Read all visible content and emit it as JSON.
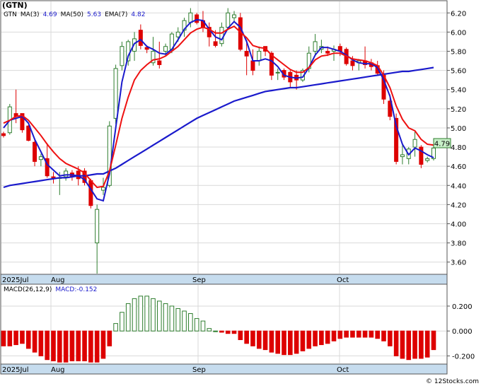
{
  "header": {
    "symbol": "(GTN)",
    "legend": [
      {
        "label": "GTN",
        "color": "#000000"
      },
      {
        "label": "MA(3)",
        "color": "#000000"
      },
      {
        "label": "4.69",
        "color": "#1a1acc"
      },
      {
        "label": "MA(50)",
        "color": "#000000"
      },
      {
        "label": "5.63",
        "color": "#1a1acc"
      },
      {
        "label": "EMA(7)",
        "color": "#000000"
      },
      {
        "label": "4.82",
        "color": "#1a1acc"
      }
    ]
  },
  "price_panel": {
    "last_price_label": "4.79",
    "y_ticks": [
      "6.20",
      "6.00",
      "5.80",
      "5.60",
      "5.40",
      "5.20",
      "5.00",
      "4.80",
      "4.60",
      "4.40",
      "4.20",
      "4.00",
      "3.80",
      "3.60"
    ],
    "x_labels": [
      "2025Jul",
      "Aug",
      "Sep",
      "Oct"
    ]
  },
  "macd_panel": {
    "legend": [
      {
        "label": "MACD(26,12,9)",
        "color": "#000000"
      },
      {
        "label": "MACD:-0.152",
        "color": "#1a1acc"
      }
    ],
    "y_ticks": [
      "0.200",
      "0.000",
      "-0.200"
    ],
    "x_labels": [
      "2025Jul",
      "Aug",
      "Sep",
      "Oct"
    ]
  },
  "footer": {
    "credit": "© 12Stocks.com"
  },
  "colors": {
    "up": "#2e7d2e",
    "down": "#dd0000",
    "ma50": "#1a1acc",
    "ma3": "#1a1acc",
    "ema7": "#ee1111",
    "grid": "#d9d9d9",
    "axis_band": "#c6dcee",
    "label_box": "#c8f0c8"
  },
  "chart_data": [
    {
      "type": "candlestick",
      "ylim": [
        3.48,
        6.32
      ],
      "x_labels": [
        "2025Jul",
        "Aug",
        "Sep",
        "Oct"
      ],
      "series": [
        {
          "name": "GTN",
          "candles": [
            [
              4.94,
              4.96,
              4.9,
              4.92
            ],
            [
              4.95,
              5.25,
              4.93,
              5.22
            ],
            [
              5.15,
              5.4,
              5.05,
              5.12
            ],
            [
              5.15,
              5.15,
              4.95,
              4.98
            ],
            [
              5.02,
              5.03,
              4.86,
              4.87
            ],
            [
              4.85,
              4.87,
              4.6,
              4.65
            ],
            [
              4.67,
              4.73,
              4.6,
              4.7
            ],
            [
              4.68,
              4.84,
              4.48,
              4.5
            ],
            [
              4.49,
              4.54,
              4.42,
              4.48
            ],
            [
              4.48,
              4.54,
              4.3,
              4.48
            ],
            [
              4.49,
              4.58,
              4.45,
              4.55
            ],
            [
              4.53,
              4.56,
              4.45,
              4.49
            ],
            [
              4.55,
              4.6,
              4.4,
              4.47
            ],
            [
              4.55,
              4.58,
              4.4,
              4.43
            ],
            [
              4.45,
              4.47,
              4.16,
              4.19
            ],
            [
              3.8,
              4.2,
              3.48,
              4.15
            ],
            [
              4.35,
              4.48,
              4.3,
              4.38
            ],
            [
              4.4,
              5.07,
              4.38,
              5.02
            ],
            [
              5.1,
              5.66,
              5.04,
              5.62
            ],
            [
              5.65,
              5.9,
              5.6,
              5.85
            ],
            [
              5.7,
              5.92,
              5.65,
              5.9
            ],
            [
              5.8,
              6.0,
              5.7,
              5.93
            ],
            [
              6.02,
              6.08,
              5.82,
              5.86
            ],
            [
              5.84,
              5.86,
              5.78,
              5.82
            ],
            [
              5.68,
              5.95,
              5.65,
              5.8
            ],
            [
              5.7,
              5.9,
              5.62,
              5.66
            ],
            [
              5.8,
              5.88,
              5.75,
              5.85
            ],
            [
              5.82,
              6.0,
              5.78,
              5.98
            ],
            [
              5.95,
              6.05,
              5.9,
              6.0
            ],
            [
              6.02,
              6.15,
              5.95,
              6.12
            ],
            [
              6.1,
              6.25,
              6.05,
              6.2
            ],
            [
              6.18,
              6.2,
              6.08,
              6.1
            ],
            [
              6.12,
              6.22,
              6.0,
              6.05
            ],
            [
              6.05,
              6.1,
              5.85,
              5.95
            ],
            [
              5.9,
              6.02,
              5.84,
              5.86
            ],
            [
              5.88,
              6.1,
              5.85,
              6.05
            ],
            [
              6.05,
              6.25,
              6.02,
              6.2
            ],
            [
              6.15,
              6.22,
              6.1,
              6.18
            ],
            [
              6.15,
              6.2,
              5.8,
              5.82
            ],
            [
              5.8,
              5.92,
              5.55,
              5.75
            ],
            [
              5.7,
              5.82,
              5.55,
              5.6
            ],
            [
              5.7,
              5.85,
              5.65,
              5.8
            ],
            [
              5.85,
              5.85,
              5.75,
              5.8
            ],
            [
              5.78,
              5.8,
              5.5,
              5.55
            ],
            [
              5.58,
              5.62,
              5.5,
              5.58
            ],
            [
              5.6,
              5.62,
              5.5,
              5.53
            ],
            [
              5.58,
              5.6,
              5.42,
              5.48
            ],
            [
              5.55,
              5.6,
              5.4,
              5.5
            ],
            [
              5.5,
              5.62,
              5.48,
              5.6
            ],
            [
              5.62,
              5.85,
              5.58,
              5.78
            ],
            [
              5.8,
              5.98,
              5.75,
              5.9
            ],
            [
              5.82,
              5.92,
              5.78,
              5.85
            ],
            [
              5.8,
              5.85,
              5.75,
              5.78
            ],
            [
              5.8,
              5.86,
              5.7,
              5.82
            ],
            [
              5.85,
              5.88,
              5.75,
              5.8
            ],
            [
              5.82,
              5.84,
              5.65,
              5.67
            ],
            [
              5.7,
              5.75,
              5.6,
              5.65
            ],
            [
              5.68,
              5.72,
              5.6,
              5.7
            ],
            [
              5.7,
              5.85,
              5.62,
              5.66
            ],
            [
              5.68,
              5.72,
              5.6,
              5.64
            ],
            [
              5.65,
              5.7,
              5.55,
              5.57
            ],
            [
              5.55,
              5.6,
              5.25,
              5.3
            ],
            [
              5.28,
              5.35,
              5.08,
              5.12
            ],
            [
              5.1,
              5.15,
              4.62,
              4.65
            ],
            [
              4.7,
              4.82,
              4.62,
              4.72
            ],
            [
              4.68,
              4.8,
              4.62,
              4.78
            ],
            [
              4.8,
              4.96,
              4.7,
              4.88
            ],
            [
              4.8,
              4.82,
              4.58,
              4.62
            ],
            [
              4.66,
              4.7,
              4.64,
              4.68
            ],
            [
              4.68,
              4.8,
              4.66,
              4.79
            ]
          ]
        },
        {
          "name": "MA(50)",
          "values": [
            4.38,
            4.4,
            4.41,
            4.42,
            4.43,
            4.44,
            4.45,
            4.46,
            4.47,
            4.48,
            4.48,
            4.49,
            4.5,
            4.5,
            4.51,
            4.52,
            4.52,
            4.55,
            4.58,
            4.62,
            4.66,
            4.7,
            4.74,
            4.78,
            4.82,
            4.86,
            4.9,
            4.94,
            4.98,
            5.02,
            5.06,
            5.1,
            5.13,
            5.16,
            5.19,
            5.22,
            5.25,
            5.28,
            5.3,
            5.32,
            5.34,
            5.36,
            5.38,
            5.39,
            5.4,
            5.41,
            5.42,
            5.42,
            5.43,
            5.44,
            5.45,
            5.46,
            5.47,
            5.48,
            5.49,
            5.5,
            5.51,
            5.52,
            5.53,
            5.54,
            5.55,
            5.56,
            5.57,
            5.58,
            5.59,
            5.59,
            5.6,
            5.61,
            5.62,
            5.63
          ]
        },
        {
          "name": "MA(3)",
          "values": [
            5.0,
            5.08,
            5.1,
            5.12,
            5.05,
            4.88,
            4.75,
            4.62,
            4.56,
            4.5,
            4.51,
            4.51,
            4.5,
            4.46,
            4.36,
            4.26,
            4.24,
            4.52,
            5.0,
            5.48,
            5.75,
            5.88,
            5.92,
            5.85,
            5.82,
            5.78,
            5.77,
            5.82,
            5.92,
            6.03,
            6.1,
            6.13,
            6.12,
            6.03,
            5.95,
            5.92,
            6.04,
            6.11,
            6.05,
            5.9,
            5.7,
            5.7,
            5.72,
            5.7,
            5.64,
            5.55,
            5.53,
            5.52,
            5.53,
            5.63,
            5.76,
            5.84,
            5.84,
            5.82,
            5.8,
            5.76,
            5.71,
            5.68,
            5.67,
            5.67,
            5.63,
            5.5,
            5.33,
            5.02,
            4.83,
            4.72,
            4.79,
            4.76,
            4.72,
            4.69
          ]
        },
        {
          "name": "EMA(7)",
          "values": [
            5.05,
            5.08,
            5.12,
            5.13,
            5.08,
            5.0,
            4.92,
            4.83,
            4.75,
            4.68,
            4.63,
            4.6,
            4.57,
            4.53,
            4.45,
            4.38,
            4.39,
            4.55,
            4.82,
            5.1,
            5.32,
            5.5,
            5.6,
            5.66,
            5.71,
            5.72,
            5.75,
            5.8,
            5.85,
            5.92,
            5.99,
            6.03,
            6.05,
            6.03,
            5.99,
            5.99,
            6.03,
            6.06,
            6.0,
            5.94,
            5.86,
            5.84,
            5.83,
            5.76,
            5.71,
            5.66,
            5.61,
            5.58,
            5.58,
            5.63,
            5.71,
            5.75,
            5.76,
            5.78,
            5.78,
            5.75,
            5.72,
            5.71,
            5.7,
            5.68,
            5.65,
            5.55,
            5.42,
            5.23,
            5.09,
            5.0,
            4.97,
            4.88,
            4.83,
            4.82
          ]
        }
      ]
    },
    {
      "type": "bar",
      "title": "MACD(26,12,9)",
      "ylim": [
        -0.26,
        0.37
      ],
      "series": [
        {
          "name": "MACD(26,12,9)",
          "values": [
            -0.12,
            -0.12,
            -0.11,
            -0.1,
            -0.14,
            -0.17,
            -0.2,
            -0.23,
            -0.24,
            -0.25,
            -0.25,
            -0.24,
            -0.24,
            -0.24,
            -0.25,
            -0.25,
            -0.22,
            -0.12,
            0.06,
            0.15,
            0.22,
            0.26,
            0.28,
            0.28,
            0.26,
            0.24,
            0.22,
            0.2,
            0.18,
            0.16,
            0.14,
            0.1,
            0.08,
            0.02,
            0.0,
            -0.01,
            -0.02,
            -0.02,
            -0.07,
            -0.1,
            -0.12,
            -0.14,
            -0.15,
            -0.17,
            -0.18,
            -0.19,
            -0.19,
            -0.18,
            -0.16,
            -0.14,
            -0.12,
            -0.11,
            -0.1,
            -0.08,
            -0.06,
            -0.05,
            -0.05,
            -0.05,
            -0.05,
            -0.05,
            -0.06,
            -0.08,
            -0.12,
            -0.2,
            -0.22,
            -0.23,
            -0.22,
            -0.22,
            -0.21,
            -0.15
          ]
        }
      ]
    }
  ]
}
